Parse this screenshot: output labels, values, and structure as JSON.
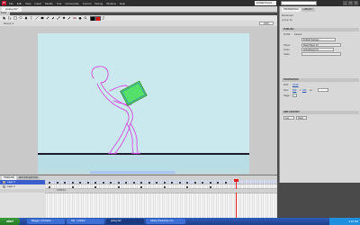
{
  "app": {
    "logo": "Fl",
    "menu": [
      "File",
      "Edit",
      "View",
      "Insert",
      "Modify",
      "Text",
      "Commands",
      "Control",
      "Debug",
      "Window",
      "Help"
    ],
    "workspace": "ESSENTIALS"
  },
  "document": {
    "tab_label": "pickup.fla*",
    "scene": "Scene 1",
    "zoom": "100%"
  },
  "tools_label": "Tools",
  "properties": {
    "tabs": [
      "PROPERTIES",
      "LIBRARY"
    ],
    "doc_title": "Document",
    "doc_name": "pickup.fla",
    "sections": {
      "publish": "PUBLISH",
      "properties": "PROPERTIES",
      "swf_history": "SWF HISTORY"
    },
    "fields": {
      "profile_label": "Profile:",
      "profile_value": "Default",
      "settings_button": "Publish Settings...",
      "player_label": "Player:",
      "player_value": "Flash Player 10",
      "script_label": "Script:",
      "script_value": "ActionScript 3.0",
      "class_label": "Class:",
      "fps_label": "FPS:",
      "fps_value": "24.00",
      "size_label": "Size:",
      "size_w": "550",
      "size_h": "400",
      "size_unit": "px",
      "stage_label": "Stage:",
      "log_button": "Log",
      "clear_button": "Clear"
    }
  },
  "timeline": {
    "tabs": [
      "TIMELINE",
      "MOTION EDITOR"
    ],
    "layers": [
      "Layer 3",
      "Layer 2",
      "Layer 1"
    ],
    "status": "24.00 fps"
  },
  "taskbar": {
    "start": "start",
    "tasks": [
      "Blogger: Animation ...",
      "SAI - Untitled",
      "pickup.fla*",
      "Adobe Photoshop CS..."
    ],
    "clock": "3:23 PM"
  },
  "colors": {
    "stage": "#c9e9ee",
    "ground": "#1c1c2a",
    "figure": "#d64be0",
    "box": "#55e06a",
    "selection": "#3a5fcd",
    "playhead": "#e02020"
  }
}
